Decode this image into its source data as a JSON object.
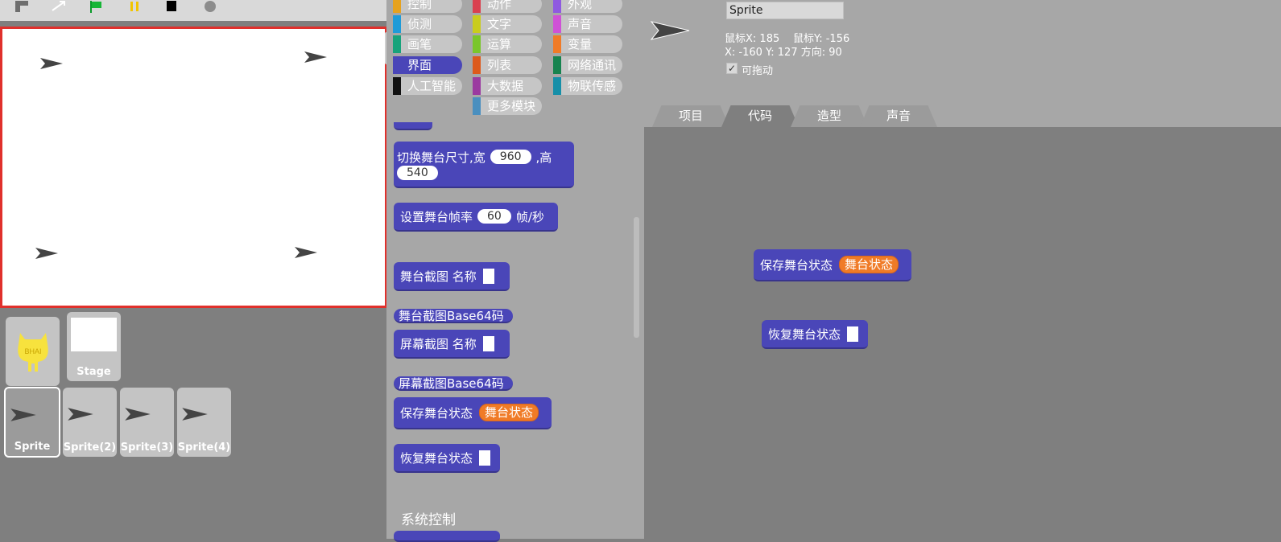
{
  "toolbar": {
    "icons": [
      "stage-size-icon",
      "fullscreen-icon",
      "green-flag-icon",
      "pause-icon",
      "stop-icon",
      "record-icon"
    ]
  },
  "corral": {
    "stage_label": "Stage",
    "stage_logo_text": "BHAI",
    "sprites": [
      "Sprite",
      "Sprite(2)",
      "Sprite(3)",
      "Sprite(4)"
    ]
  },
  "categories": {
    "col1": [
      {
        "label": "控制",
        "color": "#e6a21e"
      },
      {
        "label": "侦测",
        "color": "#1f9bd8"
      },
      {
        "label": "画笔",
        "color": "#18a37b"
      },
      {
        "label": "界面",
        "color": "#4a46b8"
      },
      {
        "label": "人工智能",
        "color": "#111111"
      }
    ],
    "col2": [
      {
        "label": "动作",
        "color": "#d9404f"
      },
      {
        "label": "文字",
        "color": "#c9cc1e"
      },
      {
        "label": "运算",
        "color": "#7ac62a"
      },
      {
        "label": "列表",
        "color": "#dd5a1c"
      },
      {
        "label": "大数据",
        "color": "#9b3aa0"
      },
      {
        "label": "更多模块",
        "color": "#4a8fbf"
      }
    ],
    "col3": [
      {
        "label": "外观",
        "color": "#8f5ae0"
      },
      {
        "label": "声音",
        "color": "#cf52d6"
      },
      {
        "label": "变量",
        "color": "#f07b27"
      },
      {
        "label": "网络通讯",
        "color": "#16834f"
      },
      {
        "label": "物联传感",
        "color": "#168fa8"
      }
    ]
  },
  "palette": {
    "resize_text": "切换舞台尺寸,宽",
    "resize_w": "960",
    "resize_h_label": ",高",
    "resize_h": "540",
    "fps_text": "设置舞台帧率",
    "fps_value": "60",
    "fps_unit": "帧/秒",
    "stage_shot": "舞台截图 名称",
    "stage_shot_b64": "舞台截图Base64码",
    "screen_shot": "屏幕截图 名称",
    "screen_shot_b64": "屏幕截图Base64码",
    "save_state": "保存舞台状态",
    "save_state_var": "舞台状态",
    "restore_state": "恢复舞台状态",
    "section_title": "系统控制"
  },
  "sprite_info": {
    "name": "Sprite",
    "mouse_x": "鼠标X: 185",
    "mouse_y": "鼠标Y: -156",
    "pos": "X: -160  Y: 127  方向: 90",
    "draggable_check": "✓",
    "draggable_label": "可拖动"
  },
  "tabs": [
    "项目",
    "代码",
    "造型",
    "声音"
  ],
  "script_area": {
    "save_state": "保存舞台状态",
    "save_state_var": "舞台状态",
    "restore_state": "恢复舞台状态"
  }
}
